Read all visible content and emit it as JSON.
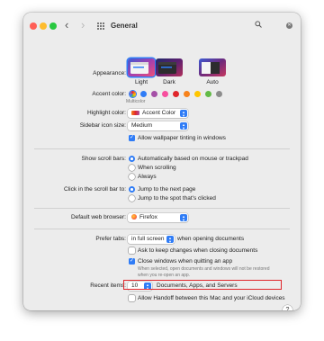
{
  "window": {
    "title": "General"
  },
  "appearance": {
    "label": "Appearance:",
    "options": [
      "Light",
      "Dark",
      "Auto"
    ],
    "selected": "Light"
  },
  "accent": {
    "label": "Accent color:",
    "caption": "Multicolor",
    "colors": [
      "multicolor",
      "#2f7cf6",
      "#a550a7",
      "#f74f9e",
      "#e0262b",
      "#f7821b",
      "#ffc600",
      "#62ba46",
      "#8c8c8c"
    ]
  },
  "highlight": {
    "label": "Highlight color:",
    "value": "Accent Color"
  },
  "sidebar": {
    "label": "Sidebar icon size:",
    "value": "Medium"
  },
  "wallpaper": {
    "label": "Allow wallpaper tinting in windows",
    "checked": true
  },
  "scrollbars": {
    "label": "Show scroll bars:",
    "options": [
      "Automatically based on mouse or trackpad",
      "When scrolling",
      "Always"
    ],
    "selected": 0
  },
  "click_scroll": {
    "label": "Click in the scroll bar to:",
    "options": [
      "Jump to the next page",
      "Jump to the spot that's clicked"
    ],
    "selected": 0
  },
  "browser": {
    "label": "Default web browser:",
    "value": "Firefox"
  },
  "tabs": {
    "label": "Prefer tabs:",
    "value": "in full screen",
    "suffix": "when opening documents"
  },
  "ask_keep": {
    "label": "Ask to keep changes when closing documents",
    "checked": false
  },
  "close_windows": {
    "label": "Close windows when quitting an app",
    "checked": true,
    "note_line1": "When selected, open documents and windows will not be restored",
    "note_line2": "when you re-open an app."
  },
  "recent": {
    "label": "Recent items:",
    "value": "10",
    "suffix": "Documents, Apps, and Servers"
  },
  "handoff": {
    "label": "Allow Handoff between this Mac and your iCloud devices",
    "checked": false
  },
  "help": "?",
  "colors": {
    "accent": "#2f7cf6",
    "highlight_box": "#e0262b",
    "window_bg": "#ececec"
  }
}
